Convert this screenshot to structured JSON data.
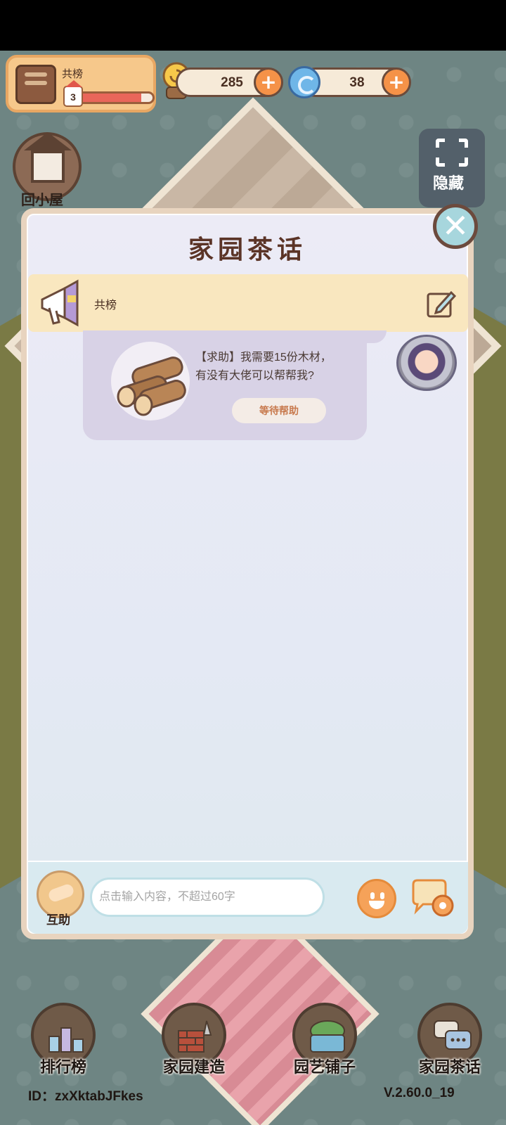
{
  "hud": {
    "profile_name": "共榜",
    "level": "3",
    "level_progress_percent": 85,
    "coins": "285",
    "gems": "38"
  },
  "left_button": {
    "label": "回小屋"
  },
  "right_button": {
    "label": "隐藏"
  },
  "modal": {
    "title": "家园茶话",
    "close_icon": "close-x-icon",
    "announcement": {
      "text": "共榜"
    },
    "messages": [
      {
        "line1": "【求助】我需要15份木材，",
        "line2": "有没有大佬可以帮帮我?",
        "action_label": "等待帮助",
        "item_icon": "wood-logs-icon"
      }
    ],
    "input": {
      "help_label": "互助",
      "placeholder": "点击输入内容，不超过60字"
    }
  },
  "bottom_nav": [
    {
      "label": "排行榜",
      "icon": "leaderboard-icon"
    },
    {
      "label": "家园建造",
      "icon": "brick-trowel-icon"
    },
    {
      "label": "园艺铺子",
      "icon": "plant-basket-icon"
    },
    {
      "label": "家园茶话",
      "icon": "chat-bubbles-icon"
    }
  ],
  "footer": {
    "id_text": "ID：zxXktabJFkes",
    "version": "V.2.60.0_19"
  },
  "colors": {
    "accent_orange": "#f59248",
    "modal_title": "#5b3427",
    "announcement_bg": "#f9e7bf"
  }
}
